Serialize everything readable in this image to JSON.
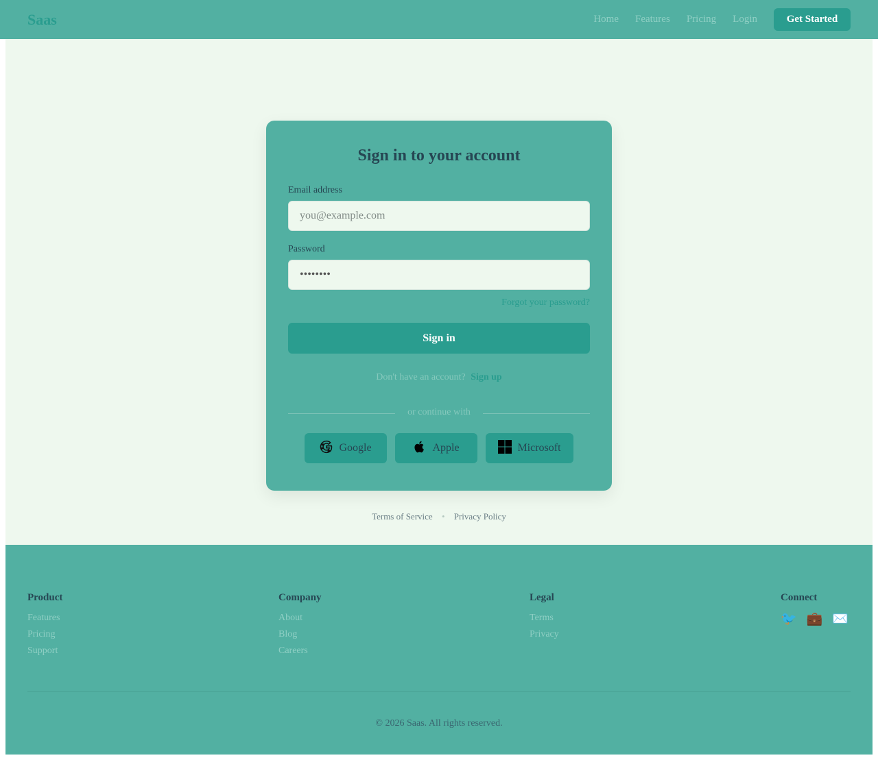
{
  "nav": {
    "brand": "Saas",
    "links": [
      "Home",
      "Features",
      "Pricing",
      "Login"
    ],
    "cta": "Get Started"
  },
  "login": {
    "title": "Sign in to your account",
    "email_label": "Email address",
    "email_placeholder": "you@example.com",
    "password_label": "Password",
    "password_value": "••••••••",
    "forgot": "Forgot your password?",
    "submit": "Sign in",
    "signup_prompt": "Don't have an account?",
    "signup_link": "Sign up",
    "divider": "or continue with",
    "social": [
      {
        "label": "Google",
        "icon": "google-icon"
      },
      {
        "label": "Apple",
        "icon": "apple-icon"
      },
      {
        "label": "Microsoft",
        "icon": "microsoft-icon"
      }
    ]
  },
  "legal": {
    "terms": "Terms of Service",
    "separator": "•",
    "privacy": "Privacy Policy"
  },
  "footer": {
    "columns": [
      {
        "heading": "Product",
        "links": [
          "Features",
          "Pricing",
          "Support"
        ]
      },
      {
        "heading": "Company",
        "links": [
          "About",
          "Blog",
          "Careers"
        ]
      },
      {
        "heading": "Legal",
        "links": [
          "Terms",
          "Privacy"
        ]
      }
    ],
    "connect": {
      "heading": "Connect",
      "icons": [
        {
          "name": "twitter-icon",
          "glyph": "🐦"
        },
        {
          "name": "briefcase-icon",
          "glyph": "💼"
        },
        {
          "name": "mail-icon",
          "glyph": "✉️"
        }
      ]
    },
    "copyright": "© 2026 Saas. All rights reserved."
  },
  "colors": {
    "primary": "#2a9d8f",
    "surface": "#52b0a2",
    "background": "#eef8ee",
    "text_dark": "#264653"
  }
}
